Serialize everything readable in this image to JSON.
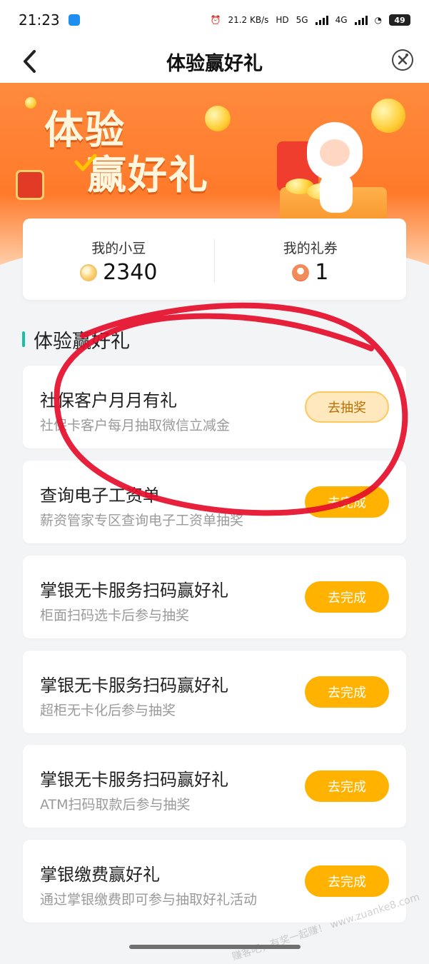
{
  "status_bar": {
    "time": "21:23",
    "speed": "21.2 KB/s",
    "network_1": "HD",
    "network_2": "5G",
    "network_3": "4G",
    "battery": "49"
  },
  "header": {
    "title": "体验赢好礼"
  },
  "hero": {
    "title_line_1": "体验",
    "title_line_2": "赢好礼"
  },
  "summary": {
    "beans_label": "我的小豆",
    "beans_value": "2340",
    "coupons_label": "我的礼券",
    "coupons_value": "1"
  },
  "section": {
    "title": "体验赢好礼"
  },
  "tasks": [
    {
      "title": "社保客户月月有礼",
      "subtitle": "社保卡客户每月抽取微信立减金",
      "button": "去抽奖"
    },
    {
      "title": "查询电子工资单",
      "subtitle": "薪资管家专区查询电子工资单抽奖",
      "button": "去完成"
    },
    {
      "title": "掌银无卡服务扫码赢好礼",
      "subtitle": "柜面扫码选卡后参与抽奖",
      "button": "去完成"
    },
    {
      "title": "掌银无卡服务扫码赢好礼",
      "subtitle": "超柜无卡化后参与抽奖",
      "button": "去完成"
    },
    {
      "title": "掌银无卡服务扫码赢好礼",
      "subtitle": "ATM扫码取款后参与抽奖",
      "button": "去完成"
    },
    {
      "title": "掌银缴费赢好礼",
      "subtitle": "通过掌银缴费即可参与抽取好礼活动",
      "button": "去完成"
    }
  ],
  "watermark": "赚客吧，有奖一起赚！ www.zuanke8.com",
  "colors": {
    "accent": "#ffb200",
    "hero": "#ff7a2b",
    "section_bar": "#19c0a5",
    "annotation": "#e50d2a"
  }
}
